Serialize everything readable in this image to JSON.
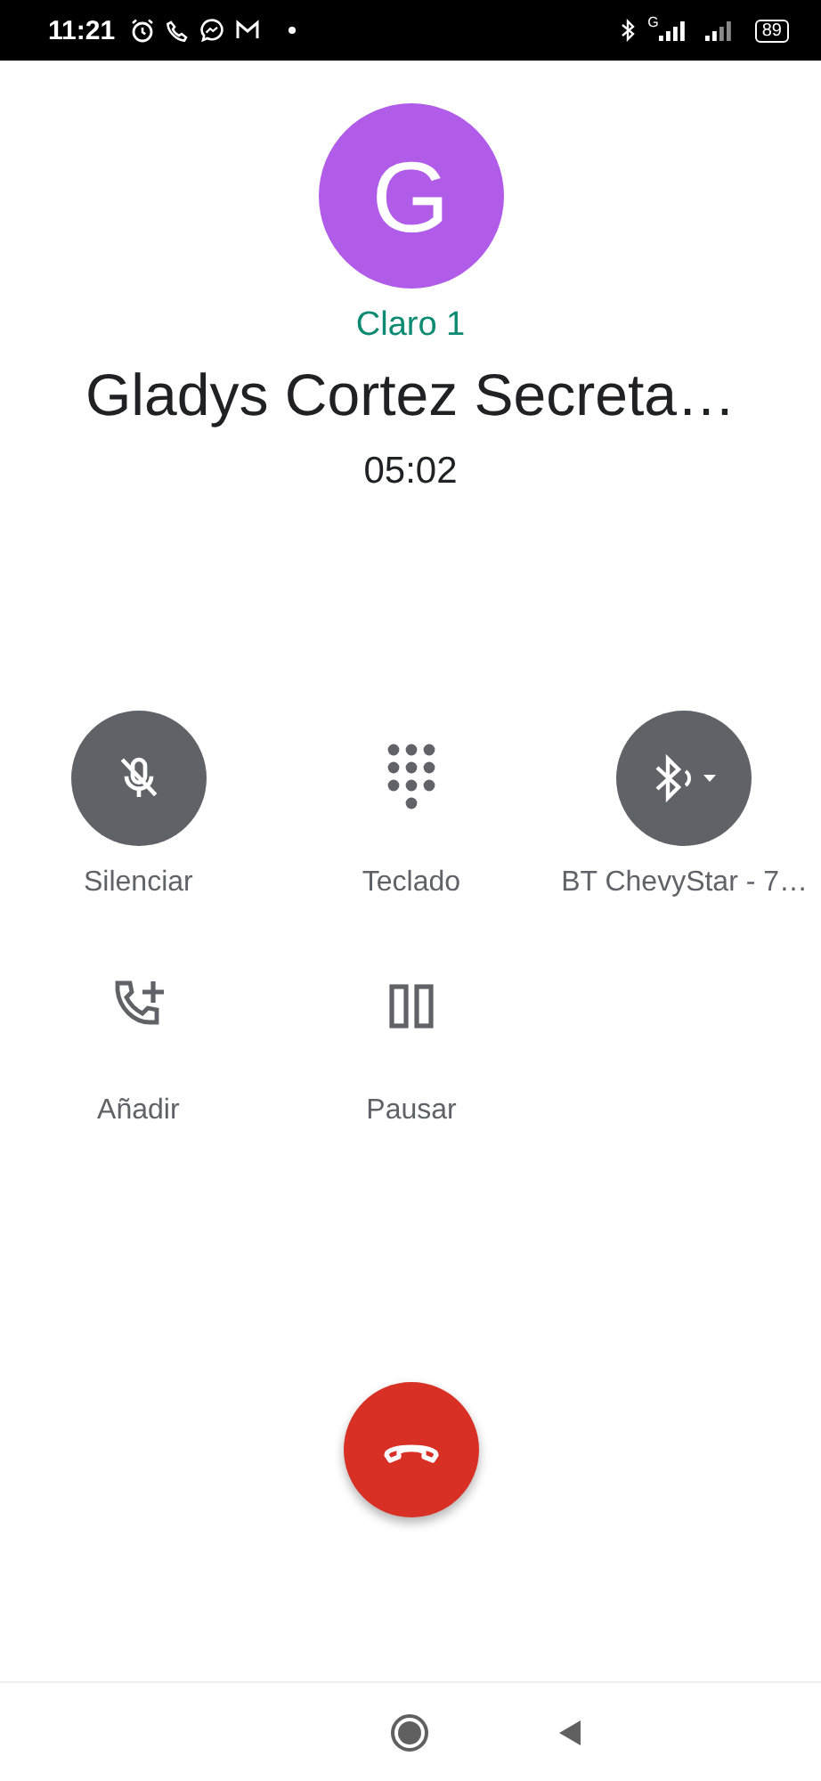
{
  "status_bar": {
    "time": "11:21",
    "network": "G",
    "battery": "89"
  },
  "caller": {
    "initial": "G",
    "sim": "Claro 1",
    "name": "Gladys Cortez Secreta…",
    "duration": "05:02"
  },
  "actions": [
    {
      "kind": "mute",
      "label": "Silenciar",
      "on": true
    },
    {
      "kind": "keypad",
      "label": "Teclado",
      "on": false
    },
    {
      "kind": "bluetooth",
      "label": "BT ChevyStar - 7…",
      "on": true
    },
    {
      "kind": "add",
      "label": "Añadir",
      "on": false
    },
    {
      "kind": "hold",
      "label": "Pausar",
      "on": false
    }
  ]
}
